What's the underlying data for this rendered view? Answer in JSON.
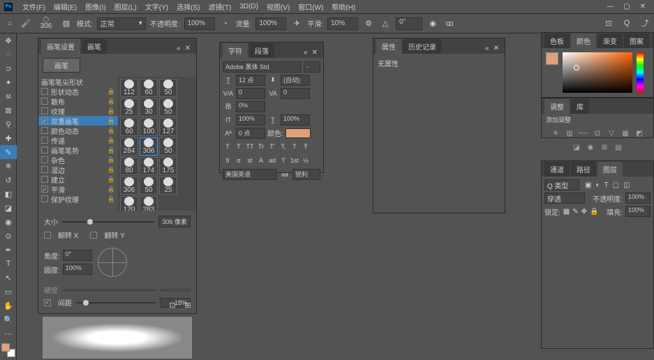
{
  "menu": {
    "items": [
      "文件(F)",
      "编辑(E)",
      "图像(I)",
      "图层(L)",
      "文字(Y)",
      "选择(S)",
      "滤镜(T)",
      "3D(D)",
      "视图(V)",
      "窗口(W)",
      "帮助(H)"
    ]
  },
  "options": {
    "brush_size": "306",
    "mode_label": "模式:",
    "mode_value": "正常",
    "opacity_label": "不透明度:",
    "opacity": "100%",
    "flow_label": "流量:",
    "flow": "100%",
    "smooth_label": "平滑:",
    "smooth": "10%",
    "angle": "0°"
  },
  "brush_panel": {
    "tabs": [
      "画笔设置",
      "画笔"
    ],
    "preset_btn": "画笔",
    "tip_label": "画笔笔尖形状",
    "opts": [
      {
        "label": "形状动态",
        "checked": false,
        "lock": true
      },
      {
        "label": "散布",
        "checked": false,
        "lock": true
      },
      {
        "label": "纹理",
        "checked": false,
        "lock": true
      },
      {
        "label": "双重画笔",
        "checked": true,
        "lock": true
      },
      {
        "label": "颜色动态",
        "checked": false,
        "lock": true
      },
      {
        "label": "传递",
        "checked": false,
        "lock": true
      },
      {
        "label": "画笔笔势",
        "checked": false,
        "lock": true
      },
      {
        "label": "杂色",
        "checked": false,
        "lock": true
      },
      {
        "label": "湿边",
        "checked": false,
        "lock": true
      },
      {
        "label": "建立",
        "checked": false,
        "lock": true
      },
      {
        "label": "平滑",
        "checked": true,
        "lock": true
      },
      {
        "label": "保护纹理",
        "checked": false,
        "lock": true
      }
    ],
    "thumbs": [
      "112",
      "60",
      "50",
      "25",
      "30",
      "50",
      "60",
      "100",
      "127",
      "284",
      "306",
      "50",
      "80",
      "174",
      "175",
      "306",
      "50",
      "25",
      "120",
      "283"
    ],
    "size_label": "大小",
    "size_val": "306 像素",
    "flipx": "翻转 X",
    "flipy": "翻转 Y",
    "angle_label": "角度:",
    "angle_val": "0°",
    "round_label": "圆度:",
    "round_val": "100%",
    "hardness_label": "硬度",
    "spacing_label": "间距",
    "spacing_val": "18%",
    "spacing_checked": true
  },
  "char_panel": {
    "tabs": [
      "字符",
      "段落"
    ],
    "font": "Adobe 黑体 Std",
    "style": "-",
    "size": "12 点",
    "leading": "(自动)",
    "va": "0",
    "tracking": "0",
    "scale": "0%",
    "vscale": "100%",
    "hscale": "100%",
    "baseline": "0 点",
    "color_label": "颜色:",
    "styles": [
      "T",
      "T",
      "TT",
      "Tr",
      "T'",
      "T,",
      "T",
      "Ŧ"
    ],
    "lang": "美国英语",
    "aa": "锐利"
  },
  "props_panel": {
    "tabs": [
      "属性",
      "历史记录"
    ],
    "empty": "无属性"
  },
  "color_panel": {
    "tabs": [
      "色板",
      "颜色",
      "渐变",
      "图案"
    ]
  },
  "adj_panel": {
    "tabs": [
      "调整",
      "库"
    ],
    "title": "添加调整"
  },
  "layers_panel": {
    "tabs": [
      "通道",
      "路径",
      "图层"
    ],
    "kind": "Q 类型",
    "mode": "穿透",
    "opacity_label": "不透明度:",
    "opacity": "100%",
    "lock_label": "锁定:",
    "fill_label": "填充:",
    "fill": "100%"
  }
}
